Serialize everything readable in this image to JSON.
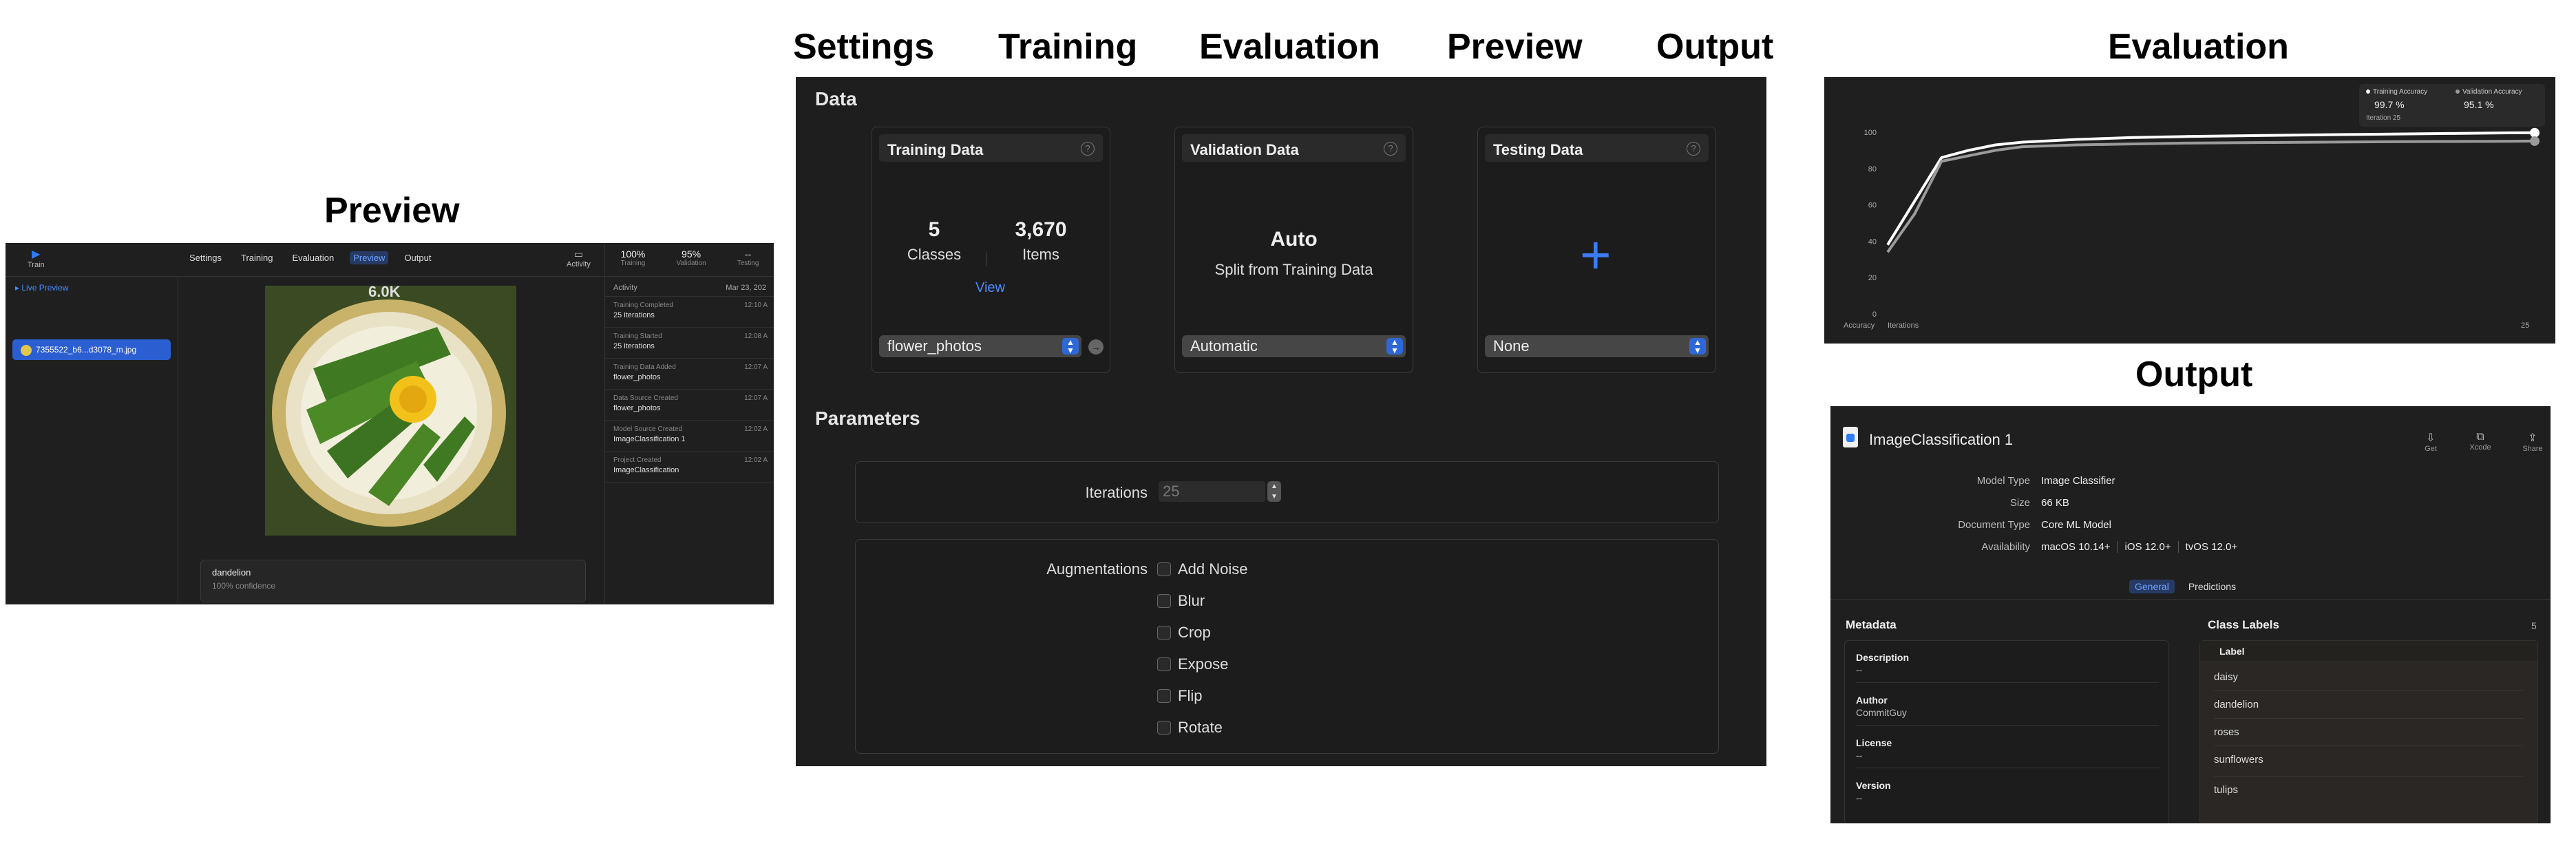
{
  "section_titles": {
    "preview": "Preview",
    "settings": "Settings",
    "training": "Training",
    "evaluation": "Evaluation",
    "preview_top": "Preview",
    "output": "Output",
    "evaluation_right": "Evaluation",
    "output_right": "Output"
  },
  "preview_panel": {
    "train_label": "Train",
    "tabs": [
      "Settings",
      "Training",
      "Evaluation",
      "Preview",
      "Output"
    ],
    "active_tab": "Preview",
    "activity_button": "Activity",
    "live_preview": "Live Preview",
    "file_name": "7355522_b6...d3078_m.jpg",
    "image_overlay_text": "6.0K",
    "result_label": "dandelion",
    "result_confidence": "100% confidence",
    "stats": [
      {
        "value": "100%",
        "label": "Training"
      },
      {
        "value": "95%",
        "label": "Validation"
      },
      {
        "value": "--",
        "label": "Testing"
      }
    ],
    "activity_header": "Activity",
    "activity_date": "Mar 23, 202",
    "activity": [
      {
        "title": "Training Completed",
        "detail": "25 iterations",
        "time": "12:10 A"
      },
      {
        "title": "Training Started",
        "detail": "25 iterations",
        "time": "12:08 A"
      },
      {
        "title": "Training Data Added",
        "detail": "flower_photos",
        "time": "12:07 A"
      },
      {
        "title": "Data Source Created",
        "detail": "flower_photos",
        "time": "12:07 A"
      },
      {
        "title": "Model Source Created",
        "detail": "ImageClassification 1",
        "time": "12:02 A"
      },
      {
        "title": "Project Created",
        "detail": "ImageClassification",
        "time": "12:02 A"
      }
    ]
  },
  "settings_panel": {
    "data_heading": "Data",
    "training_card": {
      "title": "Training Data",
      "classes_value": "5",
      "classes_label": "Classes",
      "items_value": "3,670",
      "items_label": "Items",
      "view_link": "View",
      "popup_value": "flower_photos"
    },
    "validation_card": {
      "title": "Validation Data",
      "mode": "Auto",
      "mode_desc": "Split from Training Data",
      "popup_value": "Automatic"
    },
    "testing_card": {
      "title": "Testing Data",
      "popup_value": "None"
    },
    "parameters_heading": "Parameters",
    "iterations_label": "Iterations",
    "iterations_value": "25",
    "augmentations_label": "Augmentations",
    "augmentations": [
      "Add Noise",
      "Blur",
      "Crop",
      "Expose",
      "Flip",
      "Rotate"
    ]
  },
  "evaluation_panel": {
    "legend": {
      "training_label": "Training Accuracy",
      "training_value": "99.7 %",
      "validation_label": "Validation Accuracy",
      "validation_value": "95.1 %",
      "iteration_label": "Iteration 25"
    },
    "y_axis_label": "Accuracy",
    "x_axis_label": "Iterations",
    "x_end_label": "25",
    "colors": {
      "training": "#ffffff",
      "validation": "#9a9a9a"
    }
  },
  "chart_data": {
    "type": "line",
    "title": "",
    "xlabel": "Iterations",
    "ylabel": "Accuracy",
    "ylim": [
      0,
      100
    ],
    "xlim": [
      1,
      25
    ],
    "y_ticks": [
      0,
      20,
      40,
      60,
      80,
      100
    ],
    "grid": false,
    "legend_position": "top-right",
    "series": [
      {
        "name": "Training Accuracy",
        "x": [
          1,
          2,
          3,
          4,
          5,
          6,
          8,
          10,
          12,
          15,
          18,
          20,
          22,
          24,
          25
        ],
        "y": [
          38,
          62,
          86,
          90,
          93,
          94.5,
          96,
          97,
          97.6,
          98.2,
          98.7,
          99,
          99.3,
          99.6,
          99.7
        ]
      },
      {
        "name": "Validation Accuracy",
        "x": [
          1,
          2,
          3,
          4,
          5,
          6,
          8,
          10,
          12,
          15,
          18,
          20,
          22,
          24,
          25
        ],
        "y": [
          34,
          55,
          84,
          87,
          90,
          92,
          93,
          93.5,
          94,
          94.3,
          94.6,
          94.8,
          94.9,
          95,
          95.1
        ]
      }
    ]
  },
  "output_panel": {
    "title": "ImageClassification 1",
    "actions": [
      {
        "icon": "get-icon",
        "label": "Get"
      },
      {
        "icon": "xcode-icon",
        "label": "Xcode"
      },
      {
        "icon": "share-icon",
        "label": "Share"
      }
    ],
    "model_type_label": "Model Type",
    "model_type": "Image Classifier",
    "size_label": "Size",
    "size": "66 KB",
    "document_type_label": "Document Type",
    "document_type": "Core ML Model",
    "availability_label": "Availability",
    "availability": [
      "macOS 10.14+",
      "iOS 12.0+",
      "tvOS 12.0+"
    ],
    "tabs": [
      "General",
      "Predictions"
    ],
    "active_tab": "General",
    "metadata_heading": "Metadata",
    "metadata": [
      {
        "key": "Description",
        "value": "--"
      },
      {
        "key": "Author",
        "value": "CommitGuy"
      },
      {
        "key": "License",
        "value": "--"
      },
      {
        "key": "Version",
        "value": "--"
      }
    ],
    "class_labels_heading": "Class Labels",
    "class_labels_count": "5",
    "class_labels_column": "Label",
    "class_labels": [
      "daisy",
      "dandelion",
      "roses",
      "sunflowers",
      "tulips"
    ]
  }
}
